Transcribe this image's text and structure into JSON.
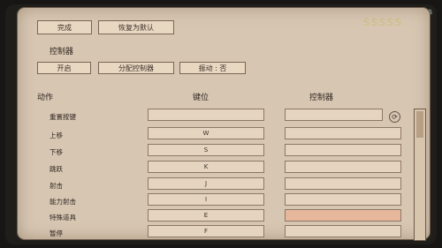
{
  "topbar": {
    "corner_text": "Vivid 🎮"
  },
  "logo_text": "SSSSS",
  "top_buttons": {
    "b1": "完成",
    "b2": "恢复为默认"
  },
  "section_title": "控制器",
  "tab_buttons": {
    "t1": "开启",
    "t2": "分配控制器",
    "t3": "振动 : 否"
  },
  "headers": {
    "action": "动作",
    "key": "键位",
    "controller": "控制器"
  },
  "rows": [
    {
      "action": "重置按键",
      "key": ""
    },
    {
      "action": "上移",
      "key": "W"
    },
    {
      "action": "下移",
      "key": "S"
    },
    {
      "action": "跳跃",
      "key": "K"
    },
    {
      "action": "射击",
      "key": "J"
    },
    {
      "action": "能力射击",
      "key": "I"
    },
    {
      "action": "特殊道具",
      "key": "E"
    },
    {
      "action": "暂停",
      "key": "F"
    }
  ],
  "colors": {
    "panel": "#d7c7b2",
    "highlight": "#e7b79c"
  },
  "icons": {
    "reset": "refresh-icon"
  }
}
